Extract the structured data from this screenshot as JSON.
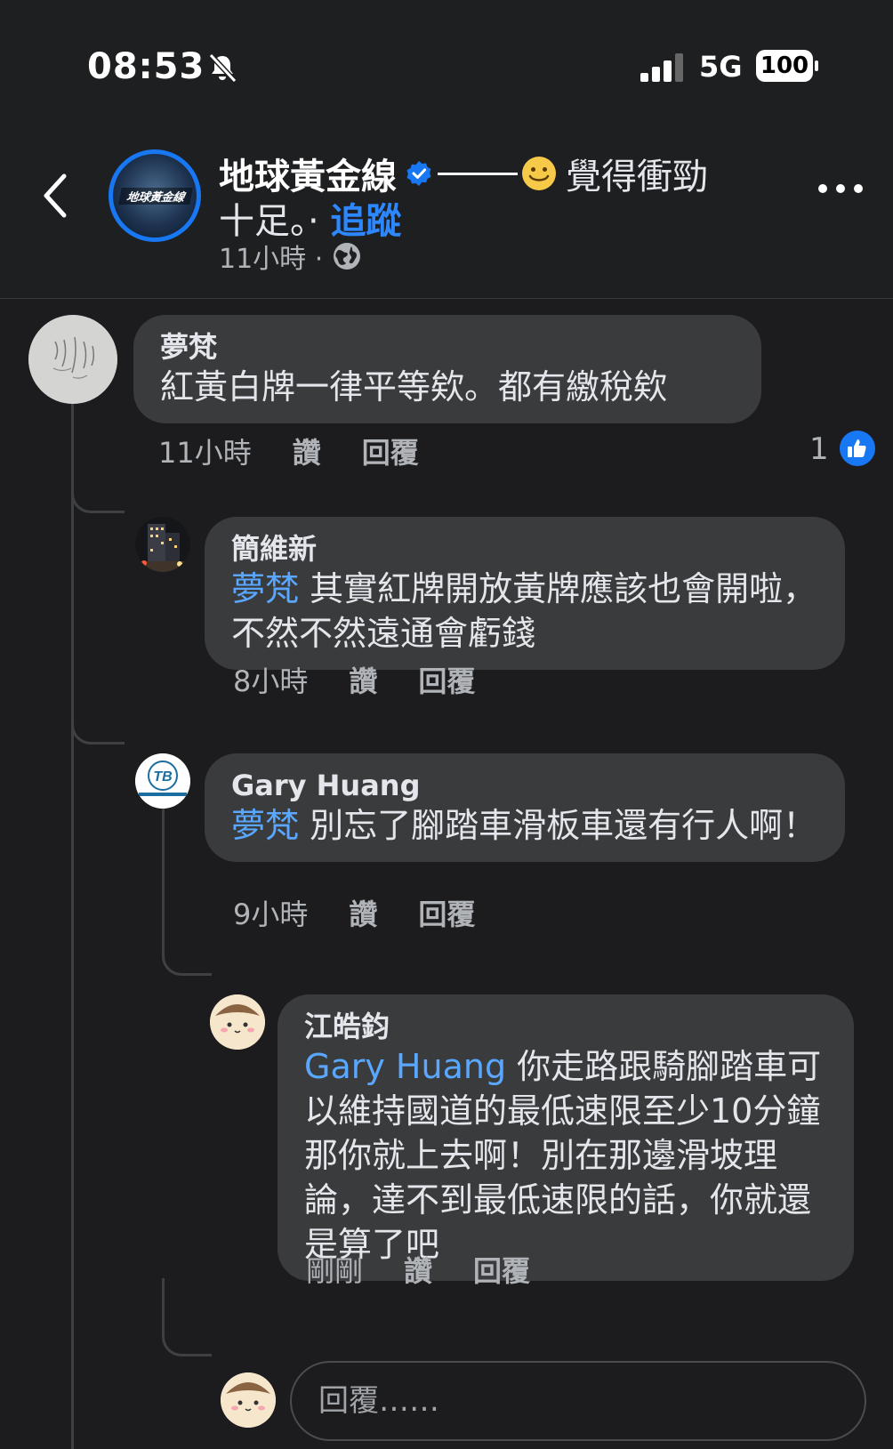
{
  "status_bar": {
    "time": "08:53",
    "network": "5G",
    "battery": "100"
  },
  "post": {
    "page_name": "地球黃金線",
    "avatar_text": "地球黃金線",
    "text_first": "覺得衝勁",
    "text_second": "十足。· ",
    "follow": "追蹤",
    "time": "11小時 ·"
  },
  "comments": [
    {
      "author": "夢梵",
      "text": "紅黃白牌一律平等欸。都有繳稅欸",
      "time": "11小時",
      "like": "讚",
      "reply": "回覆",
      "like_count": "1"
    },
    {
      "author": "簡維新",
      "mention": "夢梵",
      "text": " 其實紅牌開放黃牌應該也會開啦，不然不然遠通會虧錢",
      "time": "8小時",
      "like": "讚",
      "reply": "回覆"
    },
    {
      "author": "Gary Huang",
      "mention": "夢梵",
      "text": " 別忘了腳踏車滑板車還有行人啊！",
      "time": "9小時",
      "like": "讚",
      "reply": "回覆",
      "avatar_text": "TB"
    },
    {
      "author": "江皓鈞",
      "mention": "Gary Huang",
      "text": " 你走路跟騎腳踏車可以維持國道的最低速限至少10分鐘那你就上去啊！別在那邊滑坡理論，達不到最低速限的話，你就還是算了吧",
      "time": "剛剛",
      "like": "讚",
      "reply": "回覆"
    }
  ],
  "reply_input": {
    "placeholder": "回覆……"
  },
  "colors": {
    "accent": "#1877f2",
    "mention": "#5aa7ff",
    "bubble": "#3a3b3c",
    "background": "#1c1c1e"
  }
}
